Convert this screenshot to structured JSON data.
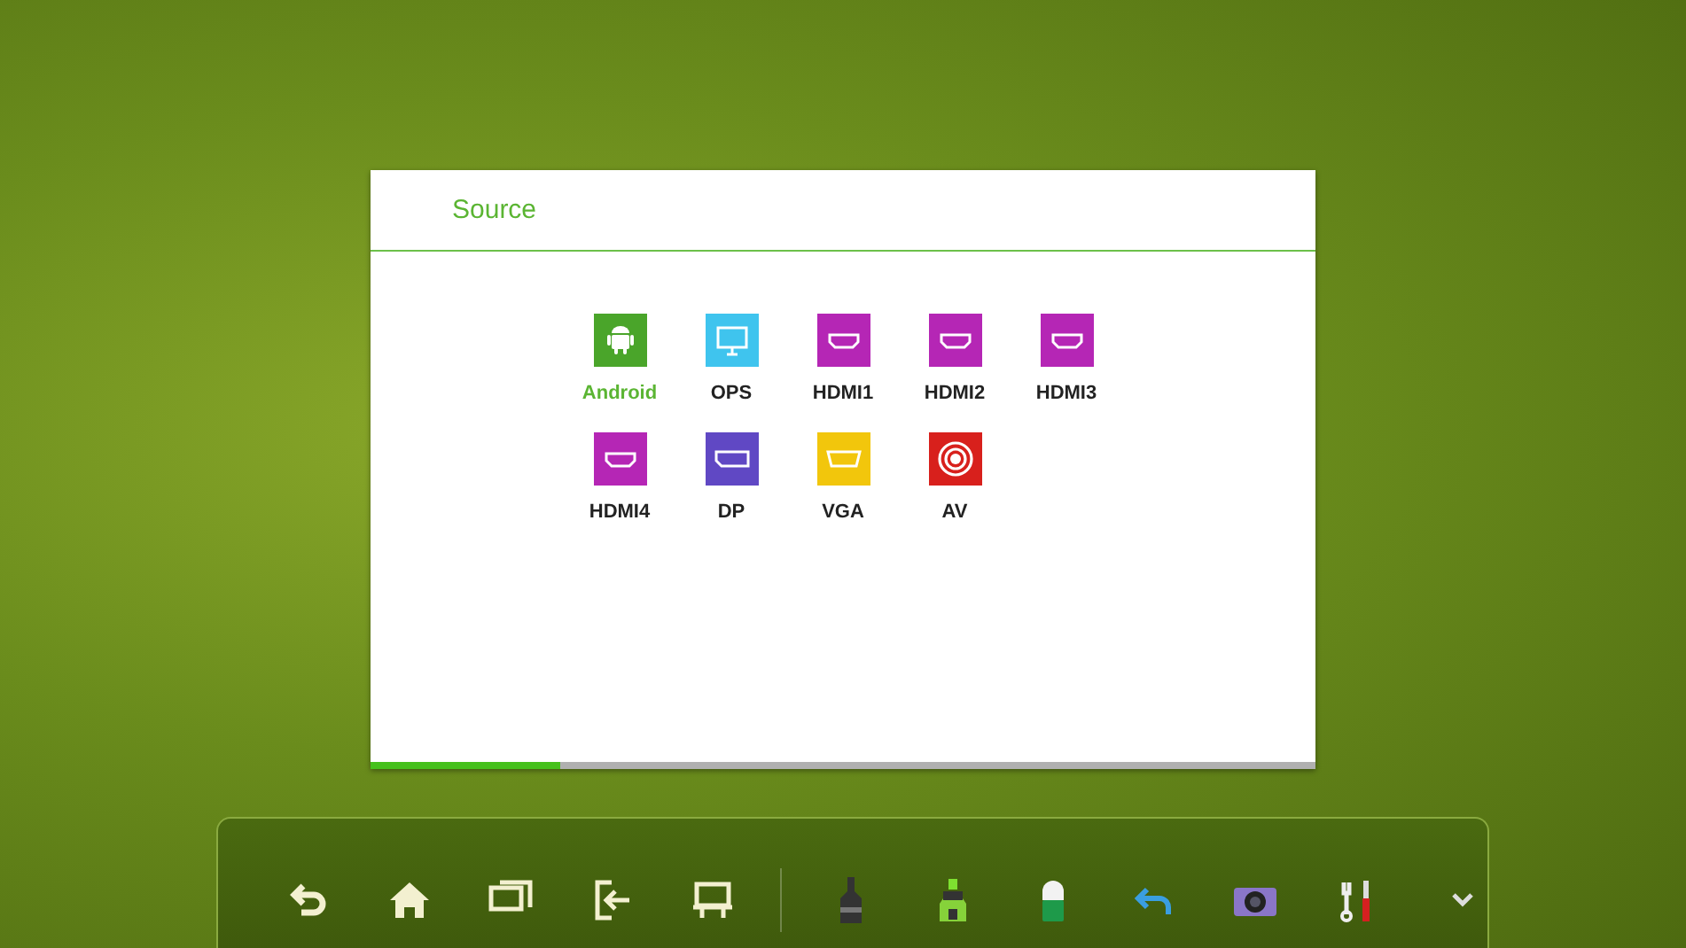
{
  "dialog": {
    "title": "Source",
    "progress": {
      "level": 0.2
    },
    "sources": [
      {
        "label": "Android",
        "kind": "android",
        "color": "#4aa52a",
        "selected": true
      },
      {
        "label": "OPS",
        "kind": "monitor",
        "color": "#3fc4ee",
        "selected": false
      },
      {
        "label": "HDMI1",
        "kind": "hdmi",
        "color": "#b526b5",
        "selected": false
      },
      {
        "label": "HDMI2",
        "kind": "hdmi",
        "color": "#b526b5",
        "selected": false
      },
      {
        "label": "HDMI3",
        "kind": "hdmi",
        "color": "#b526b5",
        "selected": false
      },
      {
        "label": "HDMI4",
        "kind": "hdmi",
        "color": "#b526b5",
        "selected": false
      },
      {
        "label": "DP",
        "kind": "dp",
        "color": "#6048c4",
        "selected": false
      },
      {
        "label": "VGA",
        "kind": "vga",
        "color": "#f2c60c",
        "selected": false
      },
      {
        "label": "AV",
        "kind": "av",
        "color": "#d8201c",
        "selected": false
      }
    ]
  },
  "toolbar": {
    "items": [
      {
        "kind": "back"
      },
      {
        "kind": "home"
      },
      {
        "kind": "windows"
      },
      {
        "kind": "input"
      },
      {
        "kind": "whiteboard"
      },
      {
        "kind": "divider"
      },
      {
        "kind": "marker"
      },
      {
        "kind": "highlighter"
      },
      {
        "kind": "eraser"
      },
      {
        "kind": "undo"
      },
      {
        "kind": "camera"
      },
      {
        "kind": "tools"
      }
    ]
  }
}
